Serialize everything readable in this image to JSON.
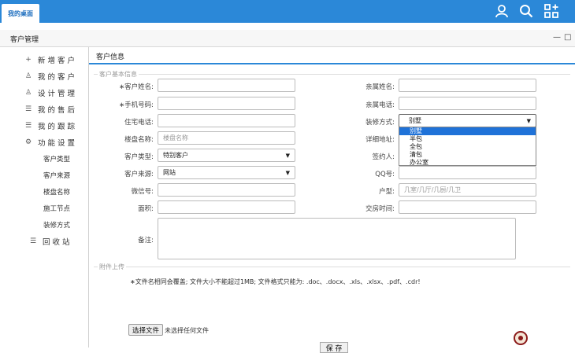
{
  "top": {
    "tab": "我的桌面",
    "icons": [
      "user-icon",
      "search-icon",
      "apps-icon"
    ],
    "accent": "#2b88d8"
  },
  "panel": {
    "title": "客户管理",
    "minimize": "—",
    "maximize": "□"
  },
  "sidebar": {
    "items": [
      {
        "icon": "plus-icon",
        "glyph": "+",
        "label": "新 增 客 户"
      },
      {
        "icon": "user-icon",
        "glyph": "♙",
        "label": "我 的 客 户"
      },
      {
        "icon": "user-icon",
        "glyph": "♙",
        "label": "设 计 管 理"
      },
      {
        "icon": "list-icon",
        "glyph": "☰",
        "label": "我 的 售 后"
      },
      {
        "icon": "list-icon",
        "glyph": "☰",
        "label": "我 的 跟 踪"
      },
      {
        "icon": "gear-icon",
        "glyph": "⚙",
        "label": "功 能 设 置"
      }
    ],
    "sub_items": [
      "客户类型",
      "客户来源",
      "楼盘名称",
      "施工节点",
      "装修方式"
    ],
    "recycle": {
      "icon": "list-icon",
      "glyph": "☰",
      "label": "回 收 站"
    }
  },
  "main": {
    "tab": "客户信息",
    "section_basic": "客户基本信息",
    "section_attach": "附件上传",
    "fields": {
      "customer_name": {
        "label": "∗客户姓名:",
        "value": ""
      },
      "mobile": {
        "label": "∗手机号码:",
        "value": ""
      },
      "home_phone": {
        "label": "住宅电话:",
        "value": ""
      },
      "building_name": {
        "label": "楼盘名称:",
        "placeholder": "楼盘名称"
      },
      "customer_type": {
        "label": "客户类型:",
        "value": "特别客户"
      },
      "customer_source": {
        "label": "客户来源:",
        "value": "网站"
      },
      "wechat": {
        "label": "微信号:",
        "value": ""
      },
      "area": {
        "label": "面积:",
        "value": ""
      },
      "remarks": {
        "label": "备注:",
        "value": ""
      },
      "relative_name": {
        "label": "亲属姓名:",
        "value": ""
      },
      "relative_phone": {
        "label": "亲属电话:",
        "value": ""
      },
      "decoration_method": {
        "label": "装修方式:",
        "value": "别墅"
      },
      "detail_address": {
        "label": "详细地址:"
      },
      "signer": {
        "label": "签约人:"
      },
      "qq": {
        "label": "QQ号:",
        "value": ""
      },
      "house_type": {
        "label": "户型:",
        "placeholder": "几室/几厅/几厨/几卫"
      },
      "handover_time": {
        "label": "交房时间:",
        "value": ""
      }
    },
    "decoration_options": [
      "别墅",
      "半包",
      "全包",
      "清包",
      "办公室"
    ],
    "selected_option": "别墅",
    "attach_note": "∗文件名相同会覆盖; 文件大小不能超过1MB; 文件格式只能为: .doc、.docx、.xls、.xlsx、.pdf、.cdr!",
    "file_button": "选择文件",
    "file_status": "未选择任何文件",
    "save_button": "保 存"
  }
}
